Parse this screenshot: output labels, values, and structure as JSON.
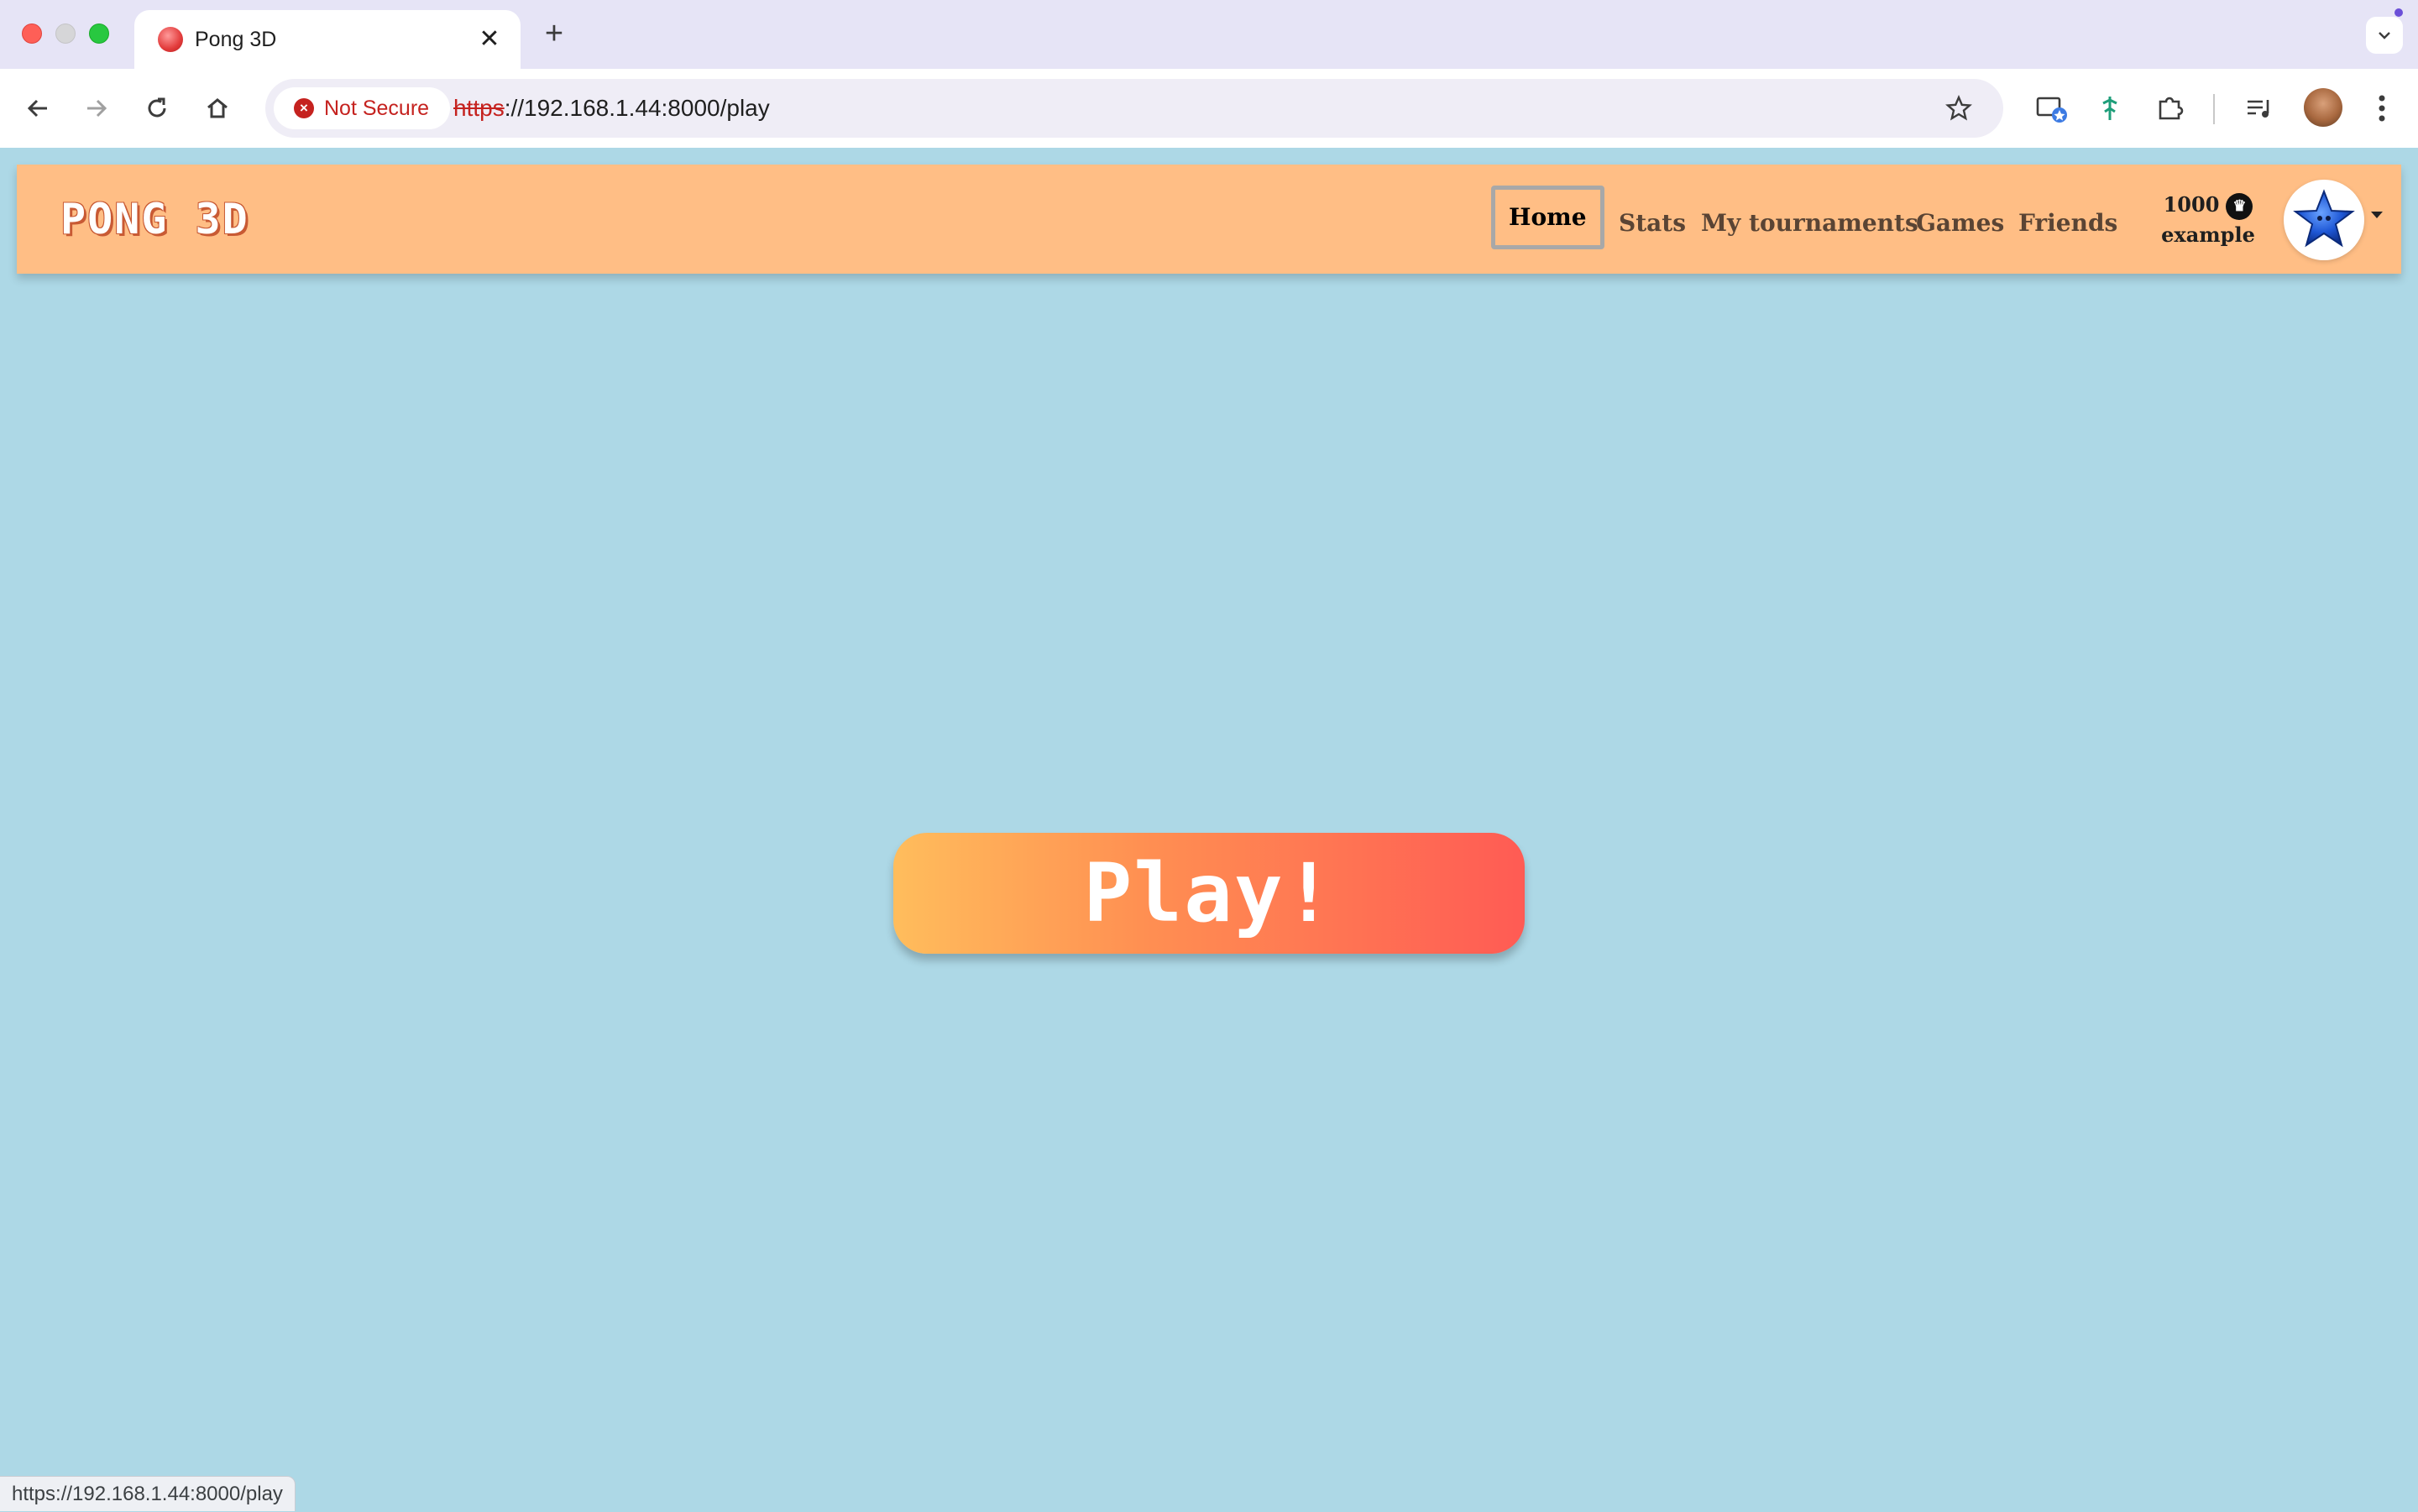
{
  "browser": {
    "tab_title": "Pong 3D",
    "tab_close": "✕",
    "new_tab": "+",
    "security_label": "Not Secure",
    "url_scheme": "https",
    "url_rest": "://192.168.1.44:8000/play",
    "status_link": "https://192.168.1.44:8000/play"
  },
  "navbar": {
    "brand": "PONG 3D",
    "links": [
      "Home",
      "Stats",
      "My tournaments",
      "Games",
      "Friends"
    ],
    "active_link": "Home",
    "elo": "1000",
    "username": "example"
  },
  "main": {
    "play_label": "Play!"
  },
  "colors": {
    "page_bg": "#add8e6",
    "navbar_bg": "#ffbe85",
    "play_gradient_start": "#ffbd5c",
    "play_gradient_end": "#ff5b54"
  },
  "icons": [
    "back-icon",
    "forward-icon",
    "reload-icon",
    "home-icon",
    "star-icon",
    "extensions-icon",
    "menu-icon",
    "trophy-icon",
    "star-avatar-icon"
  ]
}
